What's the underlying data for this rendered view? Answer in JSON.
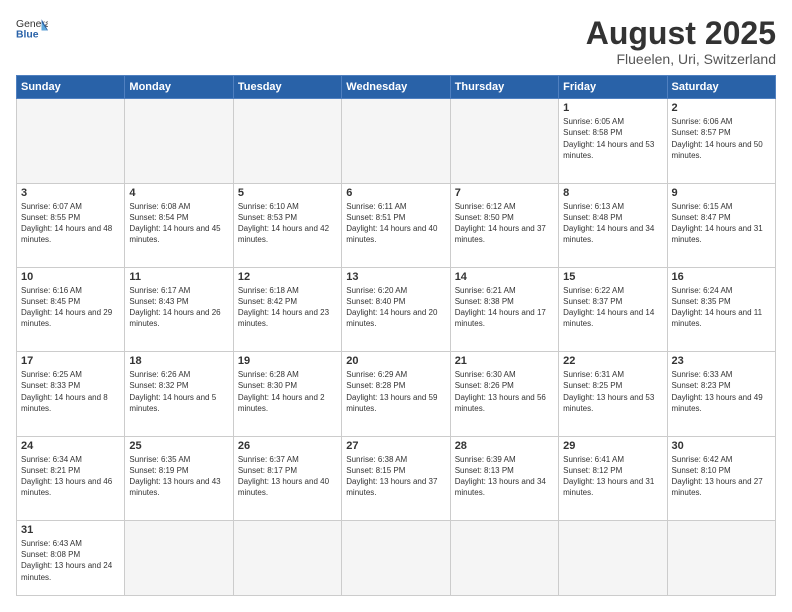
{
  "header": {
    "logo_general": "General",
    "logo_blue": "Blue",
    "title": "August 2025",
    "subtitle": "Flueelen, Uri, Switzerland"
  },
  "days_of_week": [
    "Sunday",
    "Monday",
    "Tuesday",
    "Wednesday",
    "Thursday",
    "Friday",
    "Saturday"
  ],
  "weeks": [
    [
      {
        "day": "",
        "empty": true
      },
      {
        "day": "",
        "empty": true
      },
      {
        "day": "",
        "empty": true
      },
      {
        "day": "",
        "empty": true
      },
      {
        "day": "",
        "empty": true
      },
      {
        "day": "1",
        "sunrise": "6:05 AM",
        "sunset": "8:58 PM",
        "daylight": "14 hours and 53 minutes."
      },
      {
        "day": "2",
        "sunrise": "6:06 AM",
        "sunset": "8:57 PM",
        "daylight": "14 hours and 50 minutes."
      }
    ],
    [
      {
        "day": "3",
        "sunrise": "6:07 AM",
        "sunset": "8:55 PM",
        "daylight": "14 hours and 48 minutes."
      },
      {
        "day": "4",
        "sunrise": "6:08 AM",
        "sunset": "8:54 PM",
        "daylight": "14 hours and 45 minutes."
      },
      {
        "day": "5",
        "sunrise": "6:10 AM",
        "sunset": "8:53 PM",
        "daylight": "14 hours and 42 minutes."
      },
      {
        "day": "6",
        "sunrise": "6:11 AM",
        "sunset": "8:51 PM",
        "daylight": "14 hours and 40 minutes."
      },
      {
        "day": "7",
        "sunrise": "6:12 AM",
        "sunset": "8:50 PM",
        "daylight": "14 hours and 37 minutes."
      },
      {
        "day": "8",
        "sunrise": "6:13 AM",
        "sunset": "8:48 PM",
        "daylight": "14 hours and 34 minutes."
      },
      {
        "day": "9",
        "sunrise": "6:15 AM",
        "sunset": "8:47 PM",
        "daylight": "14 hours and 31 minutes."
      }
    ],
    [
      {
        "day": "10",
        "sunrise": "6:16 AM",
        "sunset": "8:45 PM",
        "daylight": "14 hours and 29 minutes."
      },
      {
        "day": "11",
        "sunrise": "6:17 AM",
        "sunset": "8:43 PM",
        "daylight": "14 hours and 26 minutes."
      },
      {
        "day": "12",
        "sunrise": "6:18 AM",
        "sunset": "8:42 PM",
        "daylight": "14 hours and 23 minutes."
      },
      {
        "day": "13",
        "sunrise": "6:20 AM",
        "sunset": "8:40 PM",
        "daylight": "14 hours and 20 minutes."
      },
      {
        "day": "14",
        "sunrise": "6:21 AM",
        "sunset": "8:38 PM",
        "daylight": "14 hours and 17 minutes."
      },
      {
        "day": "15",
        "sunrise": "6:22 AM",
        "sunset": "8:37 PM",
        "daylight": "14 hours and 14 minutes."
      },
      {
        "day": "16",
        "sunrise": "6:24 AM",
        "sunset": "8:35 PM",
        "daylight": "14 hours and 11 minutes."
      }
    ],
    [
      {
        "day": "17",
        "sunrise": "6:25 AM",
        "sunset": "8:33 PM",
        "daylight": "14 hours and 8 minutes."
      },
      {
        "day": "18",
        "sunrise": "6:26 AM",
        "sunset": "8:32 PM",
        "daylight": "14 hours and 5 minutes."
      },
      {
        "day": "19",
        "sunrise": "6:28 AM",
        "sunset": "8:30 PM",
        "daylight": "14 hours and 2 minutes."
      },
      {
        "day": "20",
        "sunrise": "6:29 AM",
        "sunset": "8:28 PM",
        "daylight": "13 hours and 59 minutes."
      },
      {
        "day": "21",
        "sunrise": "6:30 AM",
        "sunset": "8:26 PM",
        "daylight": "13 hours and 56 minutes."
      },
      {
        "day": "22",
        "sunrise": "6:31 AM",
        "sunset": "8:25 PM",
        "daylight": "13 hours and 53 minutes."
      },
      {
        "day": "23",
        "sunrise": "6:33 AM",
        "sunset": "8:23 PM",
        "daylight": "13 hours and 49 minutes."
      }
    ],
    [
      {
        "day": "24",
        "sunrise": "6:34 AM",
        "sunset": "8:21 PM",
        "daylight": "13 hours and 46 minutes."
      },
      {
        "day": "25",
        "sunrise": "6:35 AM",
        "sunset": "8:19 PM",
        "daylight": "13 hours and 43 minutes."
      },
      {
        "day": "26",
        "sunrise": "6:37 AM",
        "sunset": "8:17 PM",
        "daylight": "13 hours and 40 minutes."
      },
      {
        "day": "27",
        "sunrise": "6:38 AM",
        "sunset": "8:15 PM",
        "daylight": "13 hours and 37 minutes."
      },
      {
        "day": "28",
        "sunrise": "6:39 AM",
        "sunset": "8:13 PM",
        "daylight": "13 hours and 34 minutes."
      },
      {
        "day": "29",
        "sunrise": "6:41 AM",
        "sunset": "8:12 PM",
        "daylight": "13 hours and 31 minutes."
      },
      {
        "day": "30",
        "sunrise": "6:42 AM",
        "sunset": "8:10 PM",
        "daylight": "13 hours and 27 minutes."
      }
    ],
    [
      {
        "day": "31",
        "sunrise": "6:43 AM",
        "sunset": "8:08 PM",
        "daylight": "13 hours and 24 minutes."
      },
      {
        "day": "",
        "empty": true
      },
      {
        "day": "",
        "empty": true
      },
      {
        "day": "",
        "empty": true
      },
      {
        "day": "",
        "empty": true
      },
      {
        "day": "",
        "empty": true
      },
      {
        "day": "",
        "empty": true
      }
    ]
  ]
}
